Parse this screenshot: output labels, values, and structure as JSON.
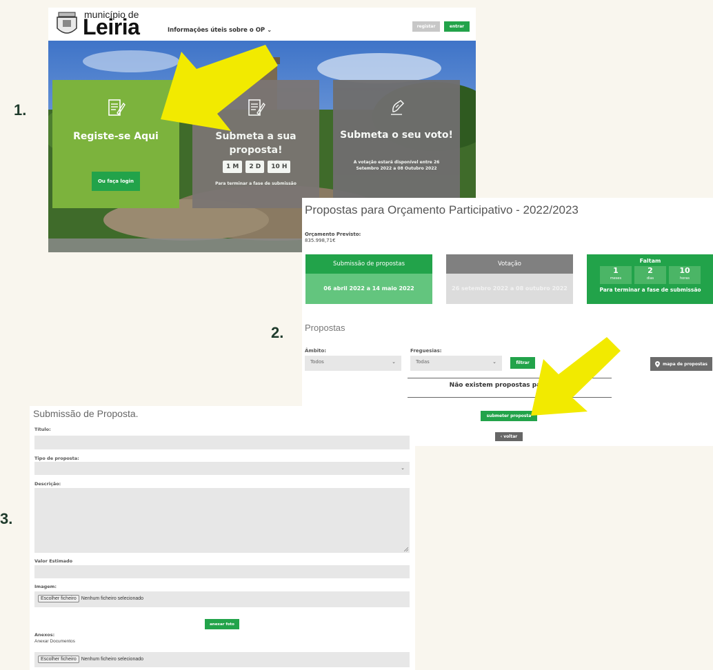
{
  "steps": {
    "s1": "1.",
    "s2": "2.",
    "s3": "3."
  },
  "panel1": {
    "brand_small": "município de",
    "brand_big": "Leiria",
    "info_link": "Informações úteis sobre o OP",
    "register_btn": "registar",
    "login_btn": "entrar",
    "card_register": {
      "title": "Registe-se Aqui",
      "button": "Ou faça login"
    },
    "card_submit": {
      "title_line1": "Submeta a sua",
      "title_line2": "proposta!",
      "counters": [
        "1 M",
        "2 D",
        "10 H"
      ],
      "note": "Para terminar a fase de submissão"
    },
    "card_vote": {
      "title": "Submeta o seu voto!",
      "note_line1": "A votação estará disponível entre 26",
      "note_line2": "Setembro 2022 a 08 Outubro 2022"
    }
  },
  "panel2": {
    "title": "Propostas para Orçamento Participativo - 2022/2023",
    "budget_label": "Orçamento Previsto:",
    "budget_value": "835.998,71€",
    "phase_submission": {
      "head": "Submissão de propostas",
      "dates": "06 abril 2022 a 14 maio 2022"
    },
    "phase_vote": {
      "head": "Votação",
      "dates": "26 setembro 2022 a 08 outubro 2022"
    },
    "remaining": {
      "title": "Faltam",
      "months": "1",
      "months_unit": "meses",
      "days": "2",
      "days_unit": "dias",
      "hours": "10",
      "hours_unit": "horas",
      "note": "Para terminar a fase de submissão"
    },
    "section_title": "Propostas",
    "scope_label": "Âmbito:",
    "scope_value": "Todos",
    "parish_label": "Freguesias:",
    "parish_value": "Todas",
    "filter_btn": "filtrar",
    "map_btn": "mapa de propostas",
    "empty_msg": "Não existem propostas para apres",
    "submit_btn": "submeter proposta",
    "back_btn": "voltar"
  },
  "panel3": {
    "title": "Submissão de Proposta.",
    "title_label": "Título:",
    "type_label": "Tipo de proposta:",
    "desc_label": "Descrição:",
    "value_label": "Valor Estimado",
    "image_label": "Imagem:",
    "file_button": "Escolher ficheiro",
    "file_none": "Nenhum ficheiro selecionado",
    "attach_photo_btn": "anexar foto",
    "attachments_label": "Anexos:",
    "attach_docs": "Anexar Documentos"
  },
  "colors": {
    "green": "#22a34a",
    "card_green": "#7cb33d",
    "arrow_yellow": "#f2ea00",
    "grey_card": "#6f6e6e"
  }
}
